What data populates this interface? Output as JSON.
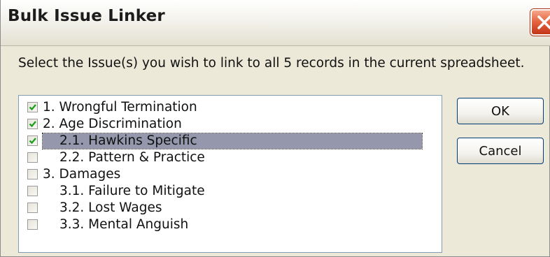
{
  "window": {
    "title": "Bulk Issue Linker"
  },
  "prompt": "Select the Issue(s) you wish to link to all 5 records in the current spreadsheet.",
  "issues": [
    {
      "label": "1.  Wrongful Termination",
      "checked": true,
      "selected": false
    },
    {
      "label": "2.  Age Discrimination",
      "checked": true,
      "selected": false
    },
    {
      "label": "2.1.  Hawkins Specific",
      "checked": true,
      "selected": true
    },
    {
      "label": "2.2.  Pattern & Practice",
      "checked": false,
      "selected": false
    },
    {
      "label": "3.  Damages",
      "checked": false,
      "selected": false
    },
    {
      "label": "3.1.  Failure to Mitigate",
      "checked": false,
      "selected": false
    },
    {
      "label": "3.2.  Lost Wages",
      "checked": false,
      "selected": false
    },
    {
      "label": "3.3.  Mental Anguish",
      "checked": false,
      "selected": false
    }
  ],
  "buttons": {
    "ok": "OK",
    "cancel": "Cancel"
  },
  "icons": {
    "close": "close-icon",
    "check": "checkmark-icon"
  },
  "colors": {
    "check": "#21a121",
    "selection": "#9598ad",
    "close_button": "#d9532e"
  }
}
